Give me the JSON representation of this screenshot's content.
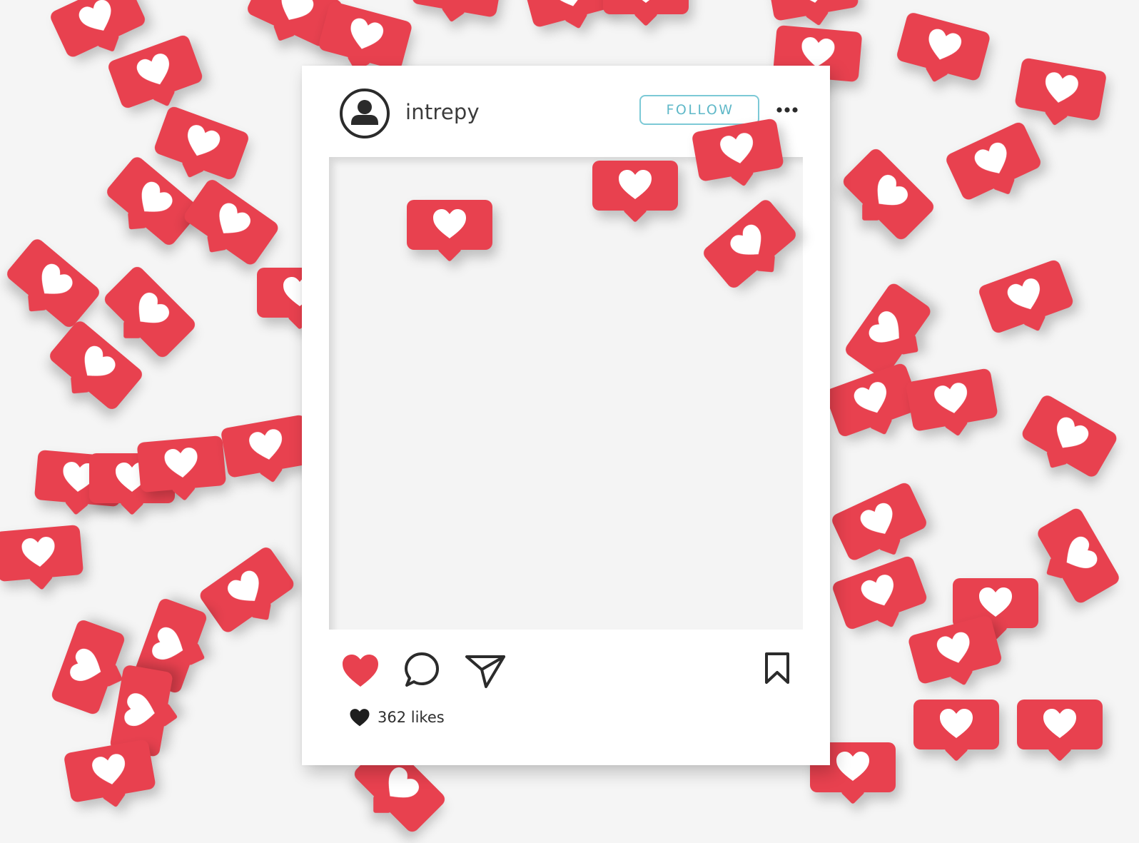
{
  "post": {
    "username": "intrepy",
    "follow_label": "FOLLOW",
    "likes_text": "362 likes"
  },
  "icons": {
    "avatar": "user-avatar-icon",
    "more": "more-options-icon",
    "like": "heart-icon",
    "comment": "comment-bubble-icon",
    "share": "paper-plane-icon",
    "save": "bookmark-icon",
    "likes": "small-heart-icon",
    "badge": "like-notification-badge"
  },
  "colors": {
    "badge_red": "#e8414f",
    "like_red": "#e8414f",
    "follow_accent": "#5fb8c8",
    "frame": "#ffffff",
    "background": "#f5f5f5"
  }
}
